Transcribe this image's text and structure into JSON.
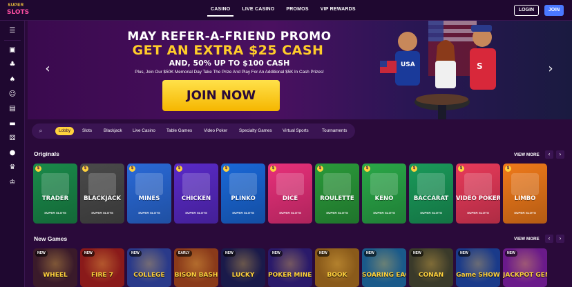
{
  "header": {
    "logo_top": "SUPER",
    "logo_bottom": "SLOTS",
    "nav": [
      "CASINO",
      "LIVE CASINO",
      "PROMOS",
      "VIP REWARDS"
    ],
    "login_label": "LOGIN",
    "join_label": "JOIN"
  },
  "sidebar": {
    "icons": [
      "menu-icon",
      "chat-icon",
      "cherries-icon",
      "spade-icon",
      "dealer-icon",
      "cards-icon",
      "table-icon",
      "dice-icon",
      "ball-icon",
      "trophy-icon",
      "crown-icon"
    ]
  },
  "banner": {
    "line1": "MAY REFER-A-FRIEND PROMO",
    "line2": "GET AN EXTRA $25 CASH",
    "line3": "AND, 50% UP TO $100 CASH",
    "subtext": "Plus, Join Our $50K Memorial Day Take The Prize And Play For An Additional $5K In Cash Prizes!",
    "cta": "JOIN NOW"
  },
  "categories": {
    "items": [
      "Lobby",
      "Slots",
      "Blackjack",
      "Live Casino",
      "Table Games",
      "Video Poker",
      "Specialty Games",
      "Virtual Sports",
      "Tournaments"
    ],
    "active": "Lobby"
  },
  "originals": {
    "title": "Originals",
    "view_more": "VIEW MORE",
    "brand": "SUPER SLOTS",
    "games": [
      {
        "name": "TRADER",
        "color": "#1a8a4a"
      },
      {
        "name": "BLACKJACK",
        "color": "#4a4a4a"
      },
      {
        "name": "MINES",
        "color": "#2a6ad8"
      },
      {
        "name": "CHICKEN",
        "color": "#5a2ac8"
      },
      {
        "name": "PLINKO",
        "color": "#1a68d8"
      },
      {
        "name": "DICE",
        "color": "#e8307a"
      },
      {
        "name": "ROULETTE",
        "color": "#2a9a3a"
      },
      {
        "name": "KENO",
        "color": "#2aa848"
      },
      {
        "name": "BACCARAT",
        "color": "#1a9a5a"
      },
      {
        "name": "VIDEO POKER",
        "color": "#e83a5a"
      },
      {
        "name": "LIMBO",
        "color": "#f07a1a"
      }
    ]
  },
  "new_games": {
    "title": "New Games",
    "view_more": "VIEW MORE",
    "games": [
      {
        "name": "WHEEL",
        "badge": "NEW",
        "color": "#3a1a2a"
      },
      {
        "name": "FIRE 7",
        "badge": "NEW",
        "color": "#8a1a1a"
      },
      {
        "name": "COLLEGE",
        "badge": "NEW",
        "color": "#2a3a8a"
      },
      {
        "name": "BISON BASH",
        "badge": "EARLY",
        "color": "#8a3a1a"
      },
      {
        "name": "LUCKY",
        "badge": "NEW",
        "color": "#1a1a4a"
      },
      {
        "name": "POKER MINES",
        "badge": "NEW",
        "color": "#2a1a6a"
      },
      {
        "name": "BOOK",
        "badge": "NEW",
        "color": "#8a5a1a"
      },
      {
        "name": "SOARING EAGLE",
        "badge": "NEW",
        "color": "#1a5a8a"
      },
      {
        "name": "CONAN",
        "badge": "NEW",
        "color": "#3a3a2a"
      },
      {
        "name": "Game SHOW",
        "badge": "NEW",
        "color": "#1a3a8a"
      },
      {
        "name": "JACKPOT GEM RUSH",
        "badge": "NEW",
        "color": "#6a1a8a"
      }
    ]
  }
}
